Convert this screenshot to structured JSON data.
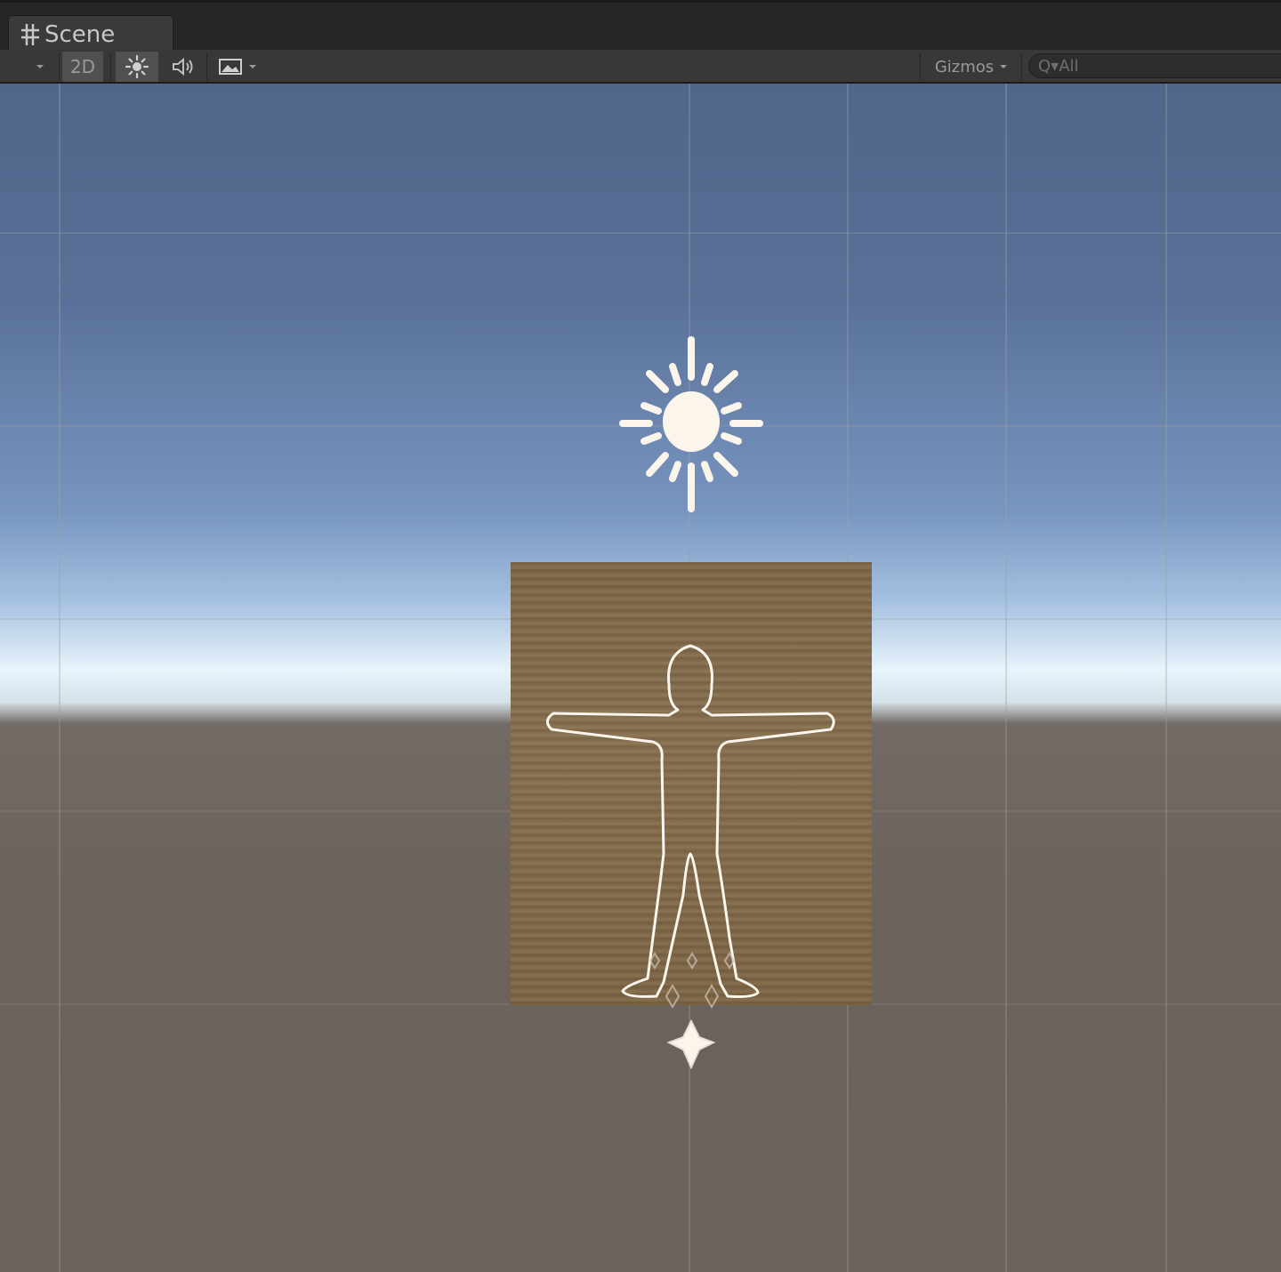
{
  "tab": {
    "label": "Scene",
    "icon": "scene-grid-icon"
  },
  "toolbar": {
    "shading_dropdown_icon": "dropdown-arrow-icon",
    "mode_2d_label": "2D",
    "lighting_icon": "sun-icon",
    "audio_icon": "speaker-icon",
    "effects_icon": "image-icon",
    "gizmos_label": "Gizmos",
    "search_text": "Q▾All"
  },
  "colors": {
    "sky_top": "#4f6589",
    "horizon": "#e8f4fb",
    "ground": "#6b625c",
    "board": "#866f50",
    "gizmo": "#fbf5ec"
  },
  "scene_objects": [
    {
      "name": "directional-light-gizmo",
      "icon": "sun-icon"
    },
    {
      "name": "humanoid-outline-board",
      "icon": "humanoid-outline"
    },
    {
      "name": "transform-pivot-gizmo",
      "icon": "star-pivot-icon"
    }
  ]
}
